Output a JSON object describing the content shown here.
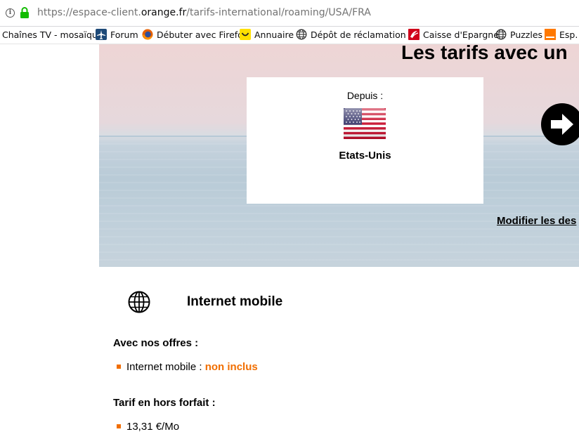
{
  "browser": {
    "url": {
      "prefix": "https://espace-client.",
      "domain": "orange.fr",
      "path": "/tarifs-international/roaming/USA/FRA"
    },
    "bookmarks": [
      {
        "label": "Chaînes TV - mosaïque",
        "icon": "none"
      },
      {
        "label": "Forum",
        "icon": "airplane-icon"
      },
      {
        "label": "Débuter avec Firefox",
        "icon": "firefox-icon"
      },
      {
        "label": "Annuaire",
        "icon": "smiley-icon"
      },
      {
        "label": "Dépôt de réclamation ...",
        "icon": "globe-icon"
      },
      {
        "label": "Caisse d'Epargne",
        "icon": "caisse-epargne-icon"
      },
      {
        "label": "Puzzles",
        "icon": "globe-icon"
      },
      {
        "label": "Esp. c",
        "icon": "orange-icon"
      }
    ]
  },
  "hero": {
    "title": "Les tarifs avec un",
    "card": {
      "from_label": "Depuis :",
      "country": "Etats-Unis",
      "flag_icon": "us-flag-icon"
    },
    "modify_link": "Modifier les des"
  },
  "section": {
    "title": "Internet mobile",
    "icon": "globe-icon",
    "offers_heading": "Avec nos offres :",
    "offers_item_label": "Internet mobile : ",
    "offers_item_value": "non inclus",
    "hors_forfait_heading": "Tarif en hors forfait :",
    "hors_forfait_value": "13,31 €/Mo"
  },
  "colors": {
    "accent_orange": "#f16e00",
    "text": "#000000"
  }
}
